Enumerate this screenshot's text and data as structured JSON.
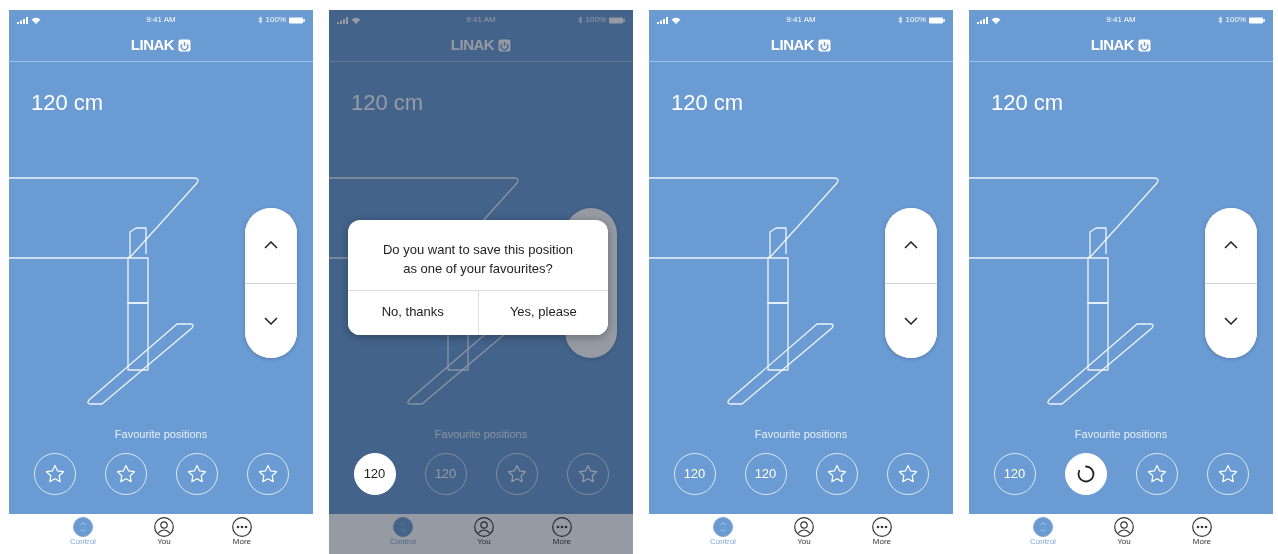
{
  "screens": [
    {
      "dimmed": false,
      "status_bar": {
        "time": "9:41 AM",
        "battery": "100%"
      },
      "logo": "LINAK",
      "height": "120 cm",
      "favourites_label": "Favourite positions",
      "favourites": [
        {
          "kind": "star",
          "highlighted": false
        },
        {
          "kind": "star",
          "highlighted": false
        },
        {
          "kind": "star",
          "highlighted": false
        },
        {
          "kind": "star",
          "highlighted": false
        }
      ],
      "tabs": [
        {
          "kind": "control",
          "label": "Control",
          "selected": true
        },
        {
          "kind": "person",
          "label": "You",
          "selected": false
        },
        {
          "kind": "more",
          "label": "More",
          "selected": false
        }
      ]
    },
    {
      "dimmed": true,
      "status_bar": {
        "time": "9:41 AM",
        "battery": "100%"
      },
      "logo": "LINAK",
      "height": "120 cm",
      "favourites_label": "Favourite positions",
      "dialog": {
        "message": "Do you want to save this position as one of your favourites?",
        "buttons": [
          "No, thanks",
          "Yes, please"
        ]
      },
      "favourites": [
        {
          "kind": "value",
          "text": "120",
          "highlighted": true
        },
        {
          "kind": "value",
          "text": "120",
          "highlighted": false
        },
        {
          "kind": "star",
          "highlighted": false
        },
        {
          "kind": "star",
          "highlighted": false
        }
      ],
      "tabs": [
        {
          "kind": "control",
          "label": "Control",
          "selected": true
        },
        {
          "kind": "person",
          "label": "You",
          "selected": false
        },
        {
          "kind": "more",
          "label": "More",
          "selected": false
        }
      ]
    },
    {
      "dimmed": false,
      "status_bar": {
        "time": "9:41 AM",
        "battery": "100%"
      },
      "logo": "LINAK",
      "height": "120 cm",
      "favourites_label": "Favourite positions",
      "favourites": [
        {
          "kind": "value",
          "text": "120",
          "highlighted": false
        },
        {
          "kind": "value",
          "text": "120",
          "highlighted": false
        },
        {
          "kind": "star",
          "highlighted": false
        },
        {
          "kind": "star",
          "highlighted": false
        }
      ],
      "tabs": [
        {
          "kind": "control",
          "label": "Control",
          "selected": true
        },
        {
          "kind": "person",
          "label": "You",
          "selected": false
        },
        {
          "kind": "more",
          "label": "More",
          "selected": false
        }
      ]
    },
    {
      "dimmed": false,
      "status_bar": {
        "time": "9:41 AM",
        "battery": "100%"
      },
      "logo": "LINAK",
      "height": "120 cm",
      "favourites_label": "Favourite positions",
      "favourites": [
        {
          "kind": "value",
          "text": "120",
          "highlighted": false
        },
        {
          "kind": "loading",
          "highlighted": true
        },
        {
          "kind": "star",
          "highlighted": false
        },
        {
          "kind": "star",
          "highlighted": false
        }
      ],
      "tabs": [
        {
          "kind": "control",
          "label": "Control",
          "selected": true
        },
        {
          "kind": "person",
          "label": "You",
          "selected": false
        },
        {
          "kind": "more",
          "label": "More",
          "selected": false
        }
      ]
    }
  ]
}
